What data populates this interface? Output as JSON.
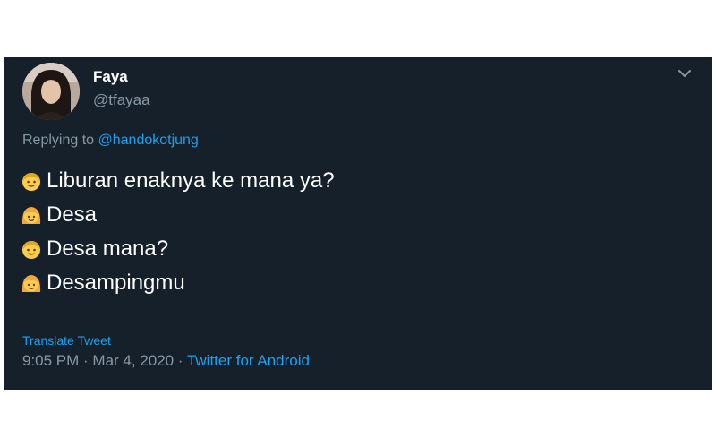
{
  "tweet": {
    "display_name": "Faya",
    "handle": "@tfayaa",
    "replying_prefix": "Replying to ",
    "replying_to": "@handokotjung",
    "lines": [
      {
        "speaker_icon": "boy-face-emoji",
        "text": "Liburan enaknya ke mana ya?"
      },
      {
        "speaker_icon": "girl-face-emoji",
        "text": "Desa"
      },
      {
        "speaker_icon": "boy-face-emoji",
        "text": "Desa mana?"
      },
      {
        "speaker_icon": "girl-face-emoji",
        "text": "Desampingmu"
      }
    ],
    "translate_label": "Translate Tweet",
    "timestamp": "9:05 PM · Mar 4, 2020",
    "separator": " · ",
    "source": "Twitter for Android"
  },
  "colors": {
    "background": "#15202b",
    "text": "#ffffff",
    "secondary_text": "#8899a6",
    "link": "#1da1f2"
  }
}
